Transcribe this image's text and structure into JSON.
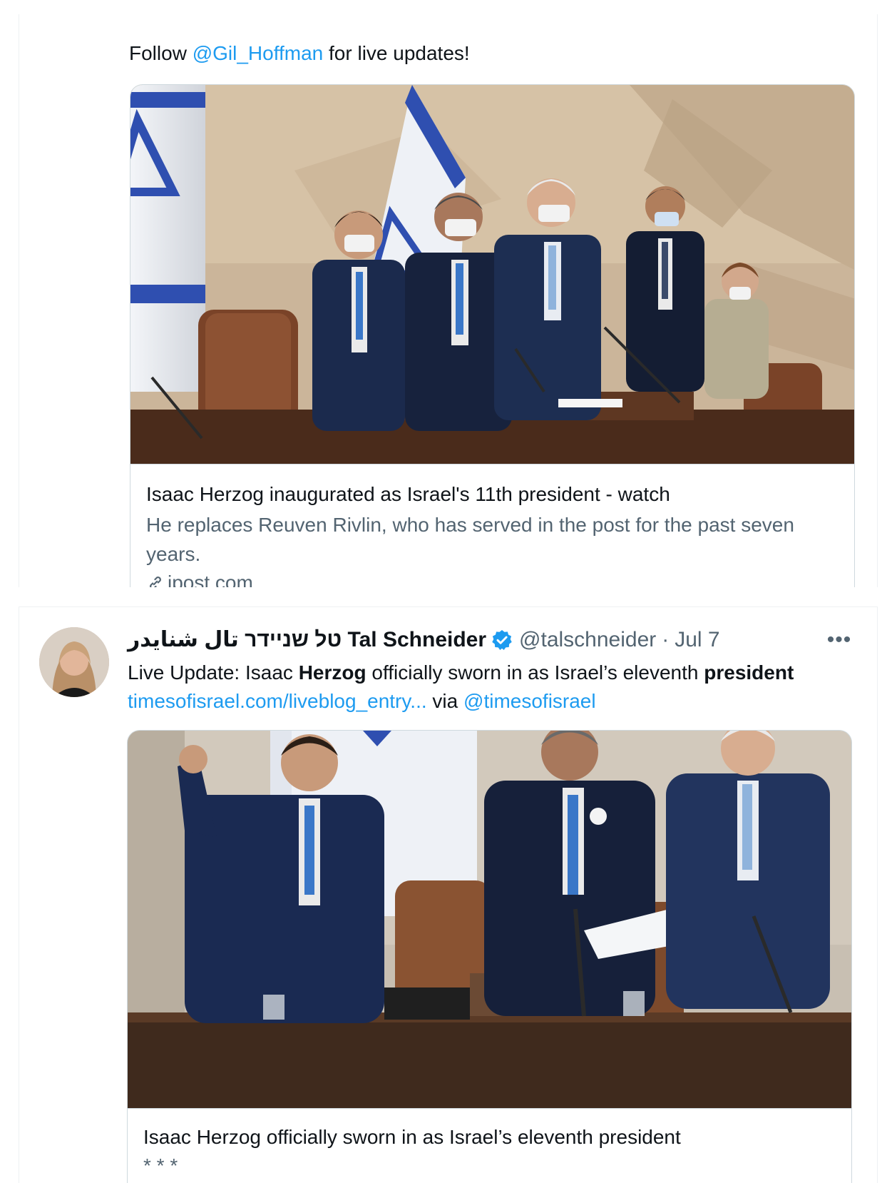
{
  "tweet1": {
    "text_prefix": "Follow ",
    "mention": "@Gil_Hoffman",
    "text_suffix": " for live updates!",
    "card": {
      "title": "Isaac Herzog inaugurated as Israel's 11th president - watch",
      "description": "He replaces Reuven Rivlin, who has served in the post for the past seven years.",
      "domain": "jpost.com",
      "icon": "link-icon"
    }
  },
  "tweet2": {
    "avatar_icon": "avatar",
    "display_name": "טל שניידר تال شنايدر Tal Schneider",
    "verified_icon": "verified-badge-icon",
    "handle": "@talschneider",
    "separator": "·",
    "date": "Jul 7",
    "more_label": "•••",
    "text": {
      "part1": "Live Update: Isaac ",
      "bold1": "Herzog",
      "part2": " officially sworn in as Israel’s eleventh ",
      "bold2": "president",
      "part3": " ",
      "url": "timesofisrael.com/liveblog_entry...",
      "part4": " via ",
      "mention": "@timesofisrael"
    },
    "card": {
      "title": "Isaac Herzog officially sworn in as Israel’s eleventh president",
      "description": "* * *"
    }
  },
  "colors": {
    "link": "#1d9bf0",
    "text": "#0f1419",
    "secondary": "#536471",
    "border": "#cfd9de",
    "flag_blue": "#2f4fb0"
  }
}
